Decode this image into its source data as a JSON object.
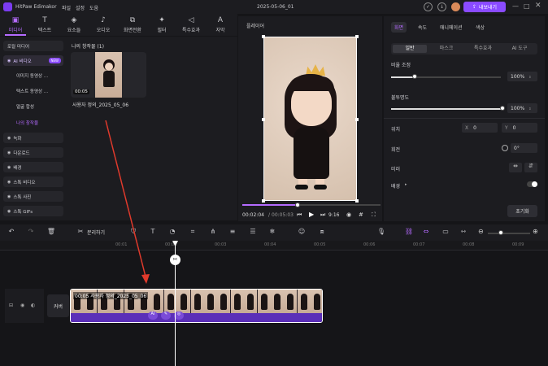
{
  "app": {
    "name": "HitPaw Edimakor",
    "menu": [
      "파일",
      "설정",
      "도움"
    ],
    "project_title": "2025-05-06_01",
    "export_label": "내보내기"
  },
  "toolbar": [
    {
      "icon": "media-icon",
      "glyph": "▣",
      "label": "미디어"
    },
    {
      "icon": "text-icon",
      "glyph": "T",
      "label": "텍스트"
    },
    {
      "icon": "elements-icon",
      "glyph": "◈",
      "label": "요소들"
    },
    {
      "icon": "audio-icon",
      "glyph": "♪",
      "label": "오디오"
    },
    {
      "icon": "transition-icon",
      "glyph": "⧉",
      "label": "화면전환"
    },
    {
      "icon": "filter-icon",
      "glyph": "✦",
      "label": "필터"
    },
    {
      "icon": "effects-icon",
      "glyph": "◁",
      "label": "특수효과"
    },
    {
      "icon": "subtitle-icon",
      "glyph": "A",
      "label": "자막"
    }
  ],
  "leftnav": {
    "items": [
      {
        "label": "로컬 미디어",
        "type": "main"
      },
      {
        "label": "AI 비디오",
        "type": "selected",
        "badge": "NEW"
      },
      {
        "label": "이미지 동영상 ...",
        "type": "sub"
      },
      {
        "label": "텍스트 동영상 ...",
        "type": "sub"
      },
      {
        "label": "얼굴 합성",
        "type": "sub"
      },
      {
        "label": "나의 창작물",
        "type": "subsel"
      },
      {
        "label": "녹화",
        "type": "main"
      },
      {
        "label": "다운로드",
        "type": "main"
      },
      {
        "label": "배경",
        "type": "main"
      },
      {
        "label": "스톡 비디오",
        "type": "main"
      },
      {
        "label": "스톡 사진",
        "type": "main"
      },
      {
        "label": "스톡 GIFs",
        "type": "main"
      }
    ]
  },
  "media": {
    "section_title": "나의 창작물 (1)",
    "item": {
      "duration": "00:05",
      "name": "사용자 정의_2025_05_06"
    }
  },
  "player": {
    "title": "플레이어",
    "current_time": "00:02:04",
    "total_time": "00:05:03",
    "ratio": "9:16",
    "progress": 0.4
  },
  "props": {
    "tabs": [
      "화면",
      "속도",
      "애니메이션",
      "색상"
    ],
    "subtabs": [
      "일반",
      "마스크",
      "특수효과",
      "AI 도구"
    ],
    "scale_label": "비율 조정",
    "scale_value": "100%",
    "opacity_label": "불투명도",
    "opacity_value": "100%",
    "position_label": "위치",
    "x_label": "X",
    "x_value": "0",
    "y_label": "Y",
    "y_value": "0",
    "rotate_label": "회전",
    "rotate_value": "0°",
    "mirror_label": "미러",
    "bg_label": "배경",
    "reset_label": "초기화"
  },
  "timeline": {
    "split_label": "분리하기",
    "ruler": [
      "00:01",
      "00:02",
      "00:03",
      "00:04",
      "00:05",
      "00:06",
      "00:07",
      "00:08",
      "00:09"
    ],
    "track_label": "커버",
    "clip_title": "00:05 사용자 정의_2025_05_06",
    "zoom": 0.3
  }
}
